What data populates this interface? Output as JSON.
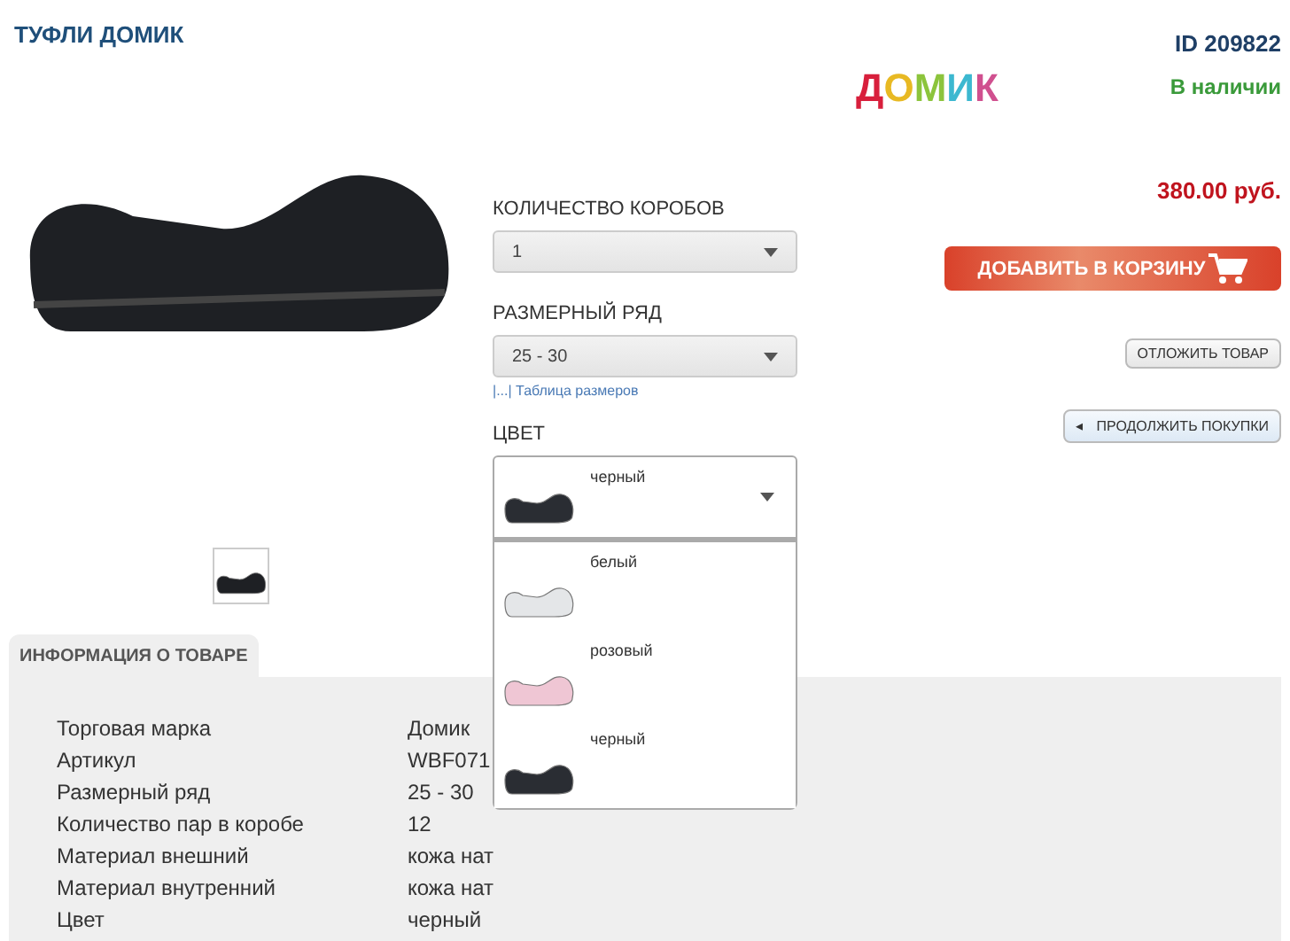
{
  "product": {
    "title": "ТУФЛИ ДОМИК",
    "id": "ID 209822",
    "availability": "В наличии",
    "price": "380.00 руб."
  },
  "logo": {
    "text": "ДОМИК"
  },
  "options": {
    "boxes": {
      "label": "КОЛИЧЕСТВО КОРОБОВ",
      "value": "1"
    },
    "size_range": {
      "label": "РАЗМЕРНЫЙ РЯД",
      "value": "25 - 30"
    },
    "size_table_link": "|...| Таблица размеров",
    "color": {
      "label": "ЦВЕТ",
      "value": "черный",
      "expanded": true,
      "items": [
        {
          "label": "белый",
          "color": "#e4e6e8"
        },
        {
          "label": "розовый",
          "color": "#efc6d4"
        },
        {
          "label": "черный",
          "color": "#2a2d33"
        }
      ]
    }
  },
  "buttons": {
    "add_to_cart": "ДОБАВИТЬ В КОРЗИНУ",
    "postpone": "ОТЛОЖИТЬ ТОВАР",
    "continue_icon": "◂",
    "continue": "ПРОДОЛЖИТЬ ПОКУПКИ"
  },
  "info": {
    "tab": "ИНФОРМАЦИЯ О ТОВАРЕ",
    "rows": [
      {
        "label": "Торговая марка",
        "value": "Домик"
      },
      {
        "label": "Артикул",
        "value": "WBF071"
      },
      {
        "label": "Размерный ряд",
        "value": "25 - 30"
      },
      {
        "label": "Количество пар в коробе",
        "value": "12"
      },
      {
        "label": "Материал внешний",
        "value": "кожа нат"
      },
      {
        "label": "Материал внутренний",
        "value": "кожа нат"
      },
      {
        "label": "Цвет",
        "value": "черный"
      }
    ]
  }
}
